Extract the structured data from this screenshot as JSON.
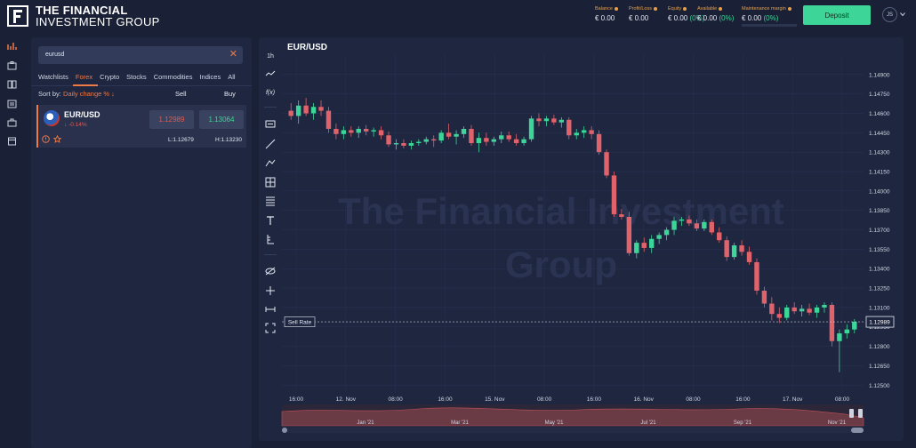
{
  "brand": {
    "line1": "THE FINANCIAL",
    "line2": "INVESTMENT GROUP"
  },
  "header": {
    "metrics": [
      {
        "label": "Balance",
        "value": "€ 0.00",
        "pct": ""
      },
      {
        "label": "Profit/Loss",
        "value": "€ 0.00",
        "pct": ""
      },
      {
        "label": "Equity",
        "value": "€ 0.00",
        "pct": "(0%)"
      },
      {
        "label": "Available",
        "value": "€ 0.00",
        "pct": "(0%)"
      },
      {
        "label": "Maintenance margin",
        "value": "€ 0.00",
        "pct": "(0%)"
      }
    ],
    "deposit_label": "Deposit",
    "avatar_initials": "JS"
  },
  "sidebar": {
    "icons": [
      "chart-icon",
      "wallet-icon",
      "book-icon",
      "news-icon",
      "briefcase-icon",
      "document-icon"
    ]
  },
  "watchlist": {
    "search_value": "eurusd",
    "tabs": [
      "Watchlists",
      "Forex",
      "Crypto",
      "Stocks",
      "Commodities",
      "Indices",
      "All"
    ],
    "active_tab": "Forex",
    "sort_label": "Sort by:",
    "sort_value": "Daily change %",
    "col_sell": "Sell",
    "col_buy": "Buy",
    "rows": [
      {
        "pair": "EUR/USD",
        "change": "-0.14%",
        "sell": "1.12989",
        "buy": "1.13064",
        "low": "L:1.12679",
        "high": "H:1.13230"
      }
    ]
  },
  "chart_panel": {
    "title": "EUR/USD",
    "timeframe": "1h",
    "fx_label": "f(x)",
    "watermark_line1": "The Financial Investment",
    "watermark_line2": "Group",
    "sell_rate_label": "Sell Rate",
    "current_price_label": "1.12989",
    "nav_months": [
      "Jan '21",
      "Mar '21",
      "May '21",
      "Jul '21",
      "Sep '21",
      "Nov '21"
    ]
  },
  "chart_data": {
    "type": "candlestick",
    "title": "EUR/USD",
    "y_ticks": [
      1.149,
      1.1475,
      1.146,
      1.1445,
      1.143,
      1.1415,
      1.14,
      1.1385,
      1.137,
      1.1355,
      1.134,
      1.1325,
      1.131,
      1.1295,
      1.128,
      1.1265,
      1.125
    ],
    "y_tick_labels": [
      "1.14900",
      "1.14750",
      "1.14600",
      "1.14450",
      "1.14300",
      "1.14150",
      "1.14000",
      "1.13850",
      "1.13700",
      "1.13550",
      "1.13400",
      "1.13250",
      "1.13100",
      "1.12950",
      "1.12800",
      "1.12650",
      "1.12500"
    ],
    "ylim": [
      1.1244,
      1.1505
    ],
    "x_tick_labels": [
      "16:00",
      "12. Nov",
      "08:00",
      "16:00",
      "15. Nov",
      "08:00",
      "16:00",
      "16. Nov",
      "08:00",
      "16:00",
      "17. Nov",
      "08:00"
    ],
    "sell_rate": 1.12989,
    "candles": [
      [
        1.1462,
        1.1468,
        1.1455,
        1.1458
      ],
      [
        1.1458,
        1.147,
        1.1452,
        1.1466
      ],
      [
        1.1466,
        1.1472,
        1.1458,
        1.146
      ],
      [
        1.146,
        1.1468,
        1.1455,
        1.1465
      ],
      [
        1.1465,
        1.147,
        1.1458,
        1.1462
      ],
      [
        1.1462,
        1.1465,
        1.1445,
        1.1448
      ],
      [
        1.1448,
        1.1452,
        1.144,
        1.1444
      ],
      [
        1.1444,
        1.145,
        1.144,
        1.1447
      ],
      [
        1.1447,
        1.145,
        1.1442,
        1.1445
      ],
      [
        1.1445,
        1.145,
        1.1441,
        1.1448
      ],
      [
        1.1448,
        1.1451,
        1.1443,
        1.1446
      ],
      [
        1.1446,
        1.1449,
        1.1442,
        1.1447
      ],
      [
        1.1447,
        1.145,
        1.144,
        1.1443
      ],
      [
        1.1443,
        1.1446,
        1.1434,
        1.1436
      ],
      [
        1.1436,
        1.144,
        1.1432,
        1.1437
      ],
      [
        1.1437,
        1.144,
        1.1433,
        1.1435
      ],
      [
        1.1435,
        1.1439,
        1.1432,
        1.1437
      ],
      [
        1.1437,
        1.144,
        1.1435,
        1.1438
      ],
      [
        1.1438,
        1.1442,
        1.1436,
        1.144
      ],
      [
        1.144,
        1.1443,
        1.1434,
        1.1439
      ],
      [
        1.1439,
        1.1447,
        1.1437,
        1.1445
      ],
      [
        1.1445,
        1.1452,
        1.144,
        1.1442
      ],
      [
        1.1442,
        1.1447,
        1.1436,
        1.1444
      ],
      [
        1.1444,
        1.145,
        1.1441,
        1.1448
      ],
      [
        1.1448,
        1.1451,
        1.1435,
        1.1437
      ],
      [
        1.1437,
        1.1445,
        1.143,
        1.1441
      ],
      [
        1.1441,
        1.1445,
        1.1435,
        1.1438
      ],
      [
        1.1438,
        1.1442,
        1.1435,
        1.144
      ],
      [
        1.144,
        1.1446,
        1.1437,
        1.1443
      ],
      [
        1.1443,
        1.1446,
        1.1438,
        1.144
      ],
      [
        1.144,
        1.1444,
        1.1435,
        1.1437
      ],
      [
        1.1437,
        1.1442,
        1.1435,
        1.144
      ],
      [
        1.144,
        1.1458,
        1.1438,
        1.1456
      ],
      [
        1.1456,
        1.146,
        1.145,
        1.1454
      ],
      [
        1.1454,
        1.1458,
        1.145,
        1.1456
      ],
      [
        1.1456,
        1.1459,
        1.1451,
        1.1453
      ],
      [
        1.1453,
        1.1457,
        1.1449,
        1.1455
      ],
      [
        1.1455,
        1.1457,
        1.144,
        1.1443
      ],
      [
        1.1443,
        1.1448,
        1.144,
        1.1445
      ],
      [
        1.1445,
        1.145,
        1.1441,
        1.1447
      ],
      [
        1.1447,
        1.145,
        1.144,
        1.1444
      ],
      [
        1.1444,
        1.1447,
        1.1428,
        1.143
      ],
      [
        1.143,
        1.1432,
        1.141,
        1.1412
      ],
      [
        1.1412,
        1.1415,
        1.138,
        1.1382
      ],
      [
        1.1382,
        1.1386,
        1.1378,
        1.138
      ],
      [
        1.138,
        1.1384,
        1.135,
        1.1352
      ],
      [
        1.1352,
        1.1362,
        1.1348,
        1.136
      ],
      [
        1.136,
        1.1364,
        1.1353,
        1.1356
      ],
      [
        1.1356,
        1.1366,
        1.1352,
        1.1363
      ],
      [
        1.1363,
        1.1368,
        1.1359,
        1.1366
      ],
      [
        1.1366,
        1.1372,
        1.1362,
        1.137
      ],
      [
        1.137,
        1.138,
        1.1366,
        1.1377
      ],
      [
        1.1377,
        1.138,
        1.1373,
        1.1378
      ],
      [
        1.1378,
        1.1381,
        1.1373,
        1.1375
      ],
      [
        1.1375,
        1.1378,
        1.1369,
        1.1371
      ],
      [
        1.1371,
        1.1378,
        1.1369,
        1.1376
      ],
      [
        1.1376,
        1.1378,
        1.1366,
        1.1368
      ],
      [
        1.1368,
        1.1372,
        1.136,
        1.1362
      ],
      [
        1.1362,
        1.1365,
        1.1346,
        1.1349
      ],
      [
        1.1349,
        1.136,
        1.1347,
        1.1358
      ],
      [
        1.1358,
        1.1362,
        1.135,
        1.1353
      ],
      [
        1.1353,
        1.1357,
        1.1343,
        1.1345
      ],
      [
        1.1345,
        1.1348,
        1.132,
        1.1323
      ],
      [
        1.1323,
        1.1326,
        1.131,
        1.1313
      ],
      [
        1.1313,
        1.1318,
        1.13,
        1.1305
      ],
      [
        1.1305,
        1.131,
        1.1298,
        1.1302
      ],
      [
        1.1302,
        1.1312,
        1.13,
        1.131
      ],
      [
        1.131,
        1.1314,
        1.1305,
        1.1307
      ],
      [
        1.1307,
        1.1312,
        1.1303,
        1.1309
      ],
      [
        1.1309,
        1.1313,
        1.1304,
        1.1306
      ],
      [
        1.1306,
        1.1312,
        1.1302,
        1.131
      ],
      [
        1.131,
        1.1314,
        1.1306,
        1.1312
      ],
      [
        1.1312,
        1.1314,
        1.128,
        1.1284
      ],
      [
        1.1284,
        1.1293,
        1.126,
        1.129
      ],
      [
        1.129,
        1.1297,
        1.1286,
        1.1293
      ],
      [
        1.1293,
        1.1301,
        1.129,
        1.1299
      ]
    ]
  }
}
